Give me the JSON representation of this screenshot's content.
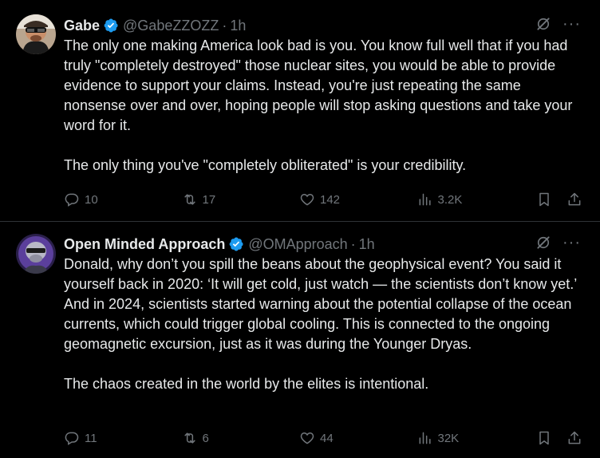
{
  "colors": {
    "background": "#000000",
    "text": "#e7e9ea",
    "muted": "#71767b",
    "verified": "#1d9bf0",
    "divider": "#2f3336"
  },
  "tweets": [
    {
      "name": "Gabe",
      "handle": "@GabeZZOZZ",
      "separator": "·",
      "time": "1h",
      "verified": true,
      "paragraphs": [
        "The only one making America look bad is you. You know full well that if you had truly \"completely destroyed\" those nuclear sites, you would be able to provide evidence to support your claims. Instead, you're just repeating the same nonsense over and over, hoping people will stop asking questions and take your word for it.",
        "The only thing you've \"completely obliterated\" is your credibility."
      ],
      "replies": "10",
      "reposts": "17",
      "likes": "142",
      "views": "3.2K"
    },
    {
      "name": "Open Minded Approach",
      "handle": "@OMApproach",
      "separator": "·",
      "time": "1h",
      "verified": true,
      "paragraphs": [
        "Donald, why don’t you spill the beans about the geophysical event? You said it yourself back in 2020: ‘It will get cold, just watch — the scientists don’t know yet.’ And in 2024, scientists started warning about the potential collapse of the ocean currents, which could trigger global cooling. This is connected to the ongoing geomagnetic excursion, just as it was during the Younger Dryas.",
        "The chaos created in the world by the elites is intentional."
      ],
      "replies": "11",
      "reposts": "6",
      "likes": "44",
      "views": "32K"
    }
  ],
  "icons": {
    "reply": "reply-icon",
    "repost": "repost-icon",
    "like": "heart-icon",
    "views": "views-icon",
    "bookmark": "bookmark-icon",
    "share": "share-icon",
    "grok": "grok-icon",
    "more": "more-icon",
    "verified": "verified-badge-icon"
  },
  "more_glyph": "···"
}
